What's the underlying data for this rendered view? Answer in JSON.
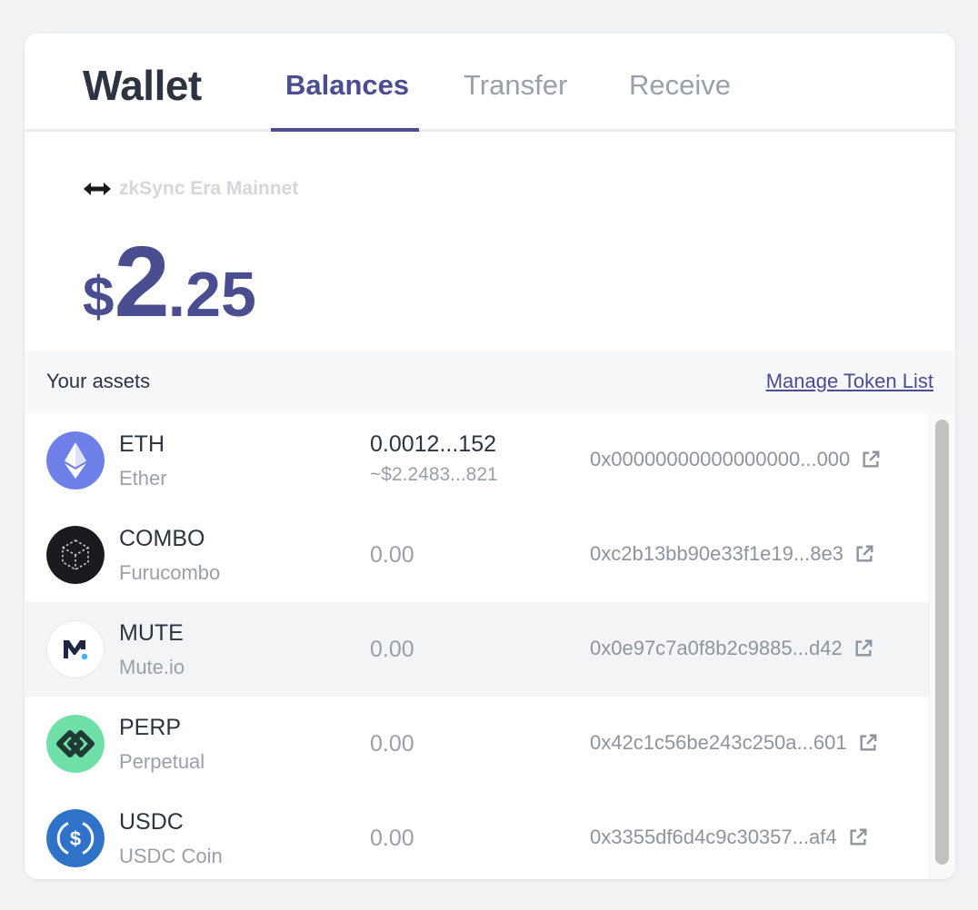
{
  "header": {
    "title": "Wallet",
    "tabs": [
      {
        "label": "Balances",
        "active": true
      },
      {
        "label": "Transfer",
        "active": false
      },
      {
        "label": "Receive",
        "active": false
      }
    ]
  },
  "network": {
    "icon": "zksync-arrows-icon",
    "label": "zkSync Era Mainnet"
  },
  "balance": {
    "symbol": "$",
    "integer": "2",
    "decimal": ".25"
  },
  "assets": {
    "title": "Your assets",
    "manage_label": "Manage Token List",
    "tokens": [
      {
        "symbol": "ETH",
        "name": "Ether",
        "amount": "0.0012...152",
        "usd": "~$2.2483...821",
        "address": "0x00000000000000000...000",
        "icon": "eth-icon",
        "color": "#6e7fe8"
      },
      {
        "symbol": "COMBO",
        "name": "Furucombo",
        "amount": "0.00",
        "usd": "",
        "address": "0xc2b13bb90e33f1e19...8e3",
        "icon": "furucombo-icon",
        "color": "#1b1b1f"
      },
      {
        "symbol": "MUTE",
        "name": "Mute.io",
        "amount": "0.00",
        "usd": "",
        "address": "0x0e97c7a0f8b2c9885...d42",
        "icon": "mute-icon",
        "color": "#ffffff"
      },
      {
        "symbol": "PERP",
        "name": "Perpetual",
        "amount": "0.00",
        "usd": "",
        "address": "0x42c1c56be243c250a...601",
        "icon": "perp-icon",
        "color": "#6fe0a8"
      },
      {
        "symbol": "USDC",
        "name": "USDC Coin",
        "amount": "0.00",
        "usd": "",
        "address": "0x3355df6d4c9c30357...af4",
        "icon": "usdc-icon",
        "color": "#2f73c8"
      }
    ]
  },
  "colors": {
    "accent": "#4b4d91",
    "text": "#2c3341",
    "muted": "#9aa0a9"
  }
}
